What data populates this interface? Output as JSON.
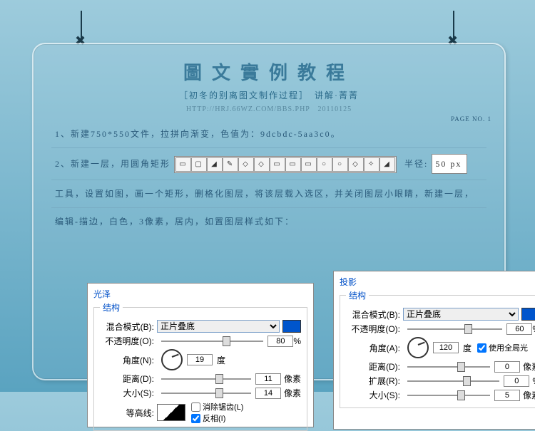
{
  "header": {
    "title": "圖文實例教程",
    "subtitle": "［初冬的别离图文制作过程］　讲解·菁菁",
    "url": "HTTP://HRJ.66WZ.COM/BBS.PHP　20110125",
    "page": "PAGE NO. 1"
  },
  "body": {
    "step1": "1、新建750*550文件，拉拼向渐变，色值为：9dcbdc-5aa3c0。",
    "step2a": "2、新建一层，用圆角矩形",
    "radius_label": "半径:",
    "radius_value": "50 px",
    "step2b": "工具，设置如图，画一个矩形，删格化图层，将该层载入选区，并关闭图层小眼睛，新建一层，",
    "step2c": "编辑-描边，白色，3像素，居内，如置图层样式如下："
  },
  "tools": [
    "▭",
    "▢",
    "◢",
    "✎",
    "◇",
    "◇",
    "▭",
    "▭",
    "▭",
    "○",
    "○",
    "◇",
    "✧",
    "◢"
  ],
  "satin": {
    "title": "光泽",
    "group": "结构",
    "blend_label": "混合模式(B):",
    "blend_value": "正片叠底",
    "opacity_label": "不透明度(O):",
    "opacity": "80",
    "angle_label": "角度(N):",
    "angle": "19",
    "angle_unit": "度",
    "dist_label": "距离(D):",
    "dist": "11",
    "dist_unit": "像素",
    "size_label": "大小(S):",
    "size": "14",
    "size_unit": "像素",
    "contour_label": "等高线:",
    "anti": "消除锯齿(L)",
    "invert": "反相(I)"
  },
  "shadow": {
    "title": "投影",
    "group": "结构",
    "blend_label": "混合模式(B):",
    "blend_value": "正片叠底",
    "opacity_label": "不透明度(O):",
    "opacity": "60",
    "angle_label": "角度(A):",
    "angle": "120",
    "angle_unit": "度",
    "global": "使用全局光",
    "dist_label": "距离(D):",
    "dist": "0",
    "dist_unit": "像素",
    "spread_label": "扩展(R):",
    "spread": "0",
    "size_label": "大小(S):",
    "size": "5",
    "size_unit": "像素"
  },
  "pct": "%"
}
